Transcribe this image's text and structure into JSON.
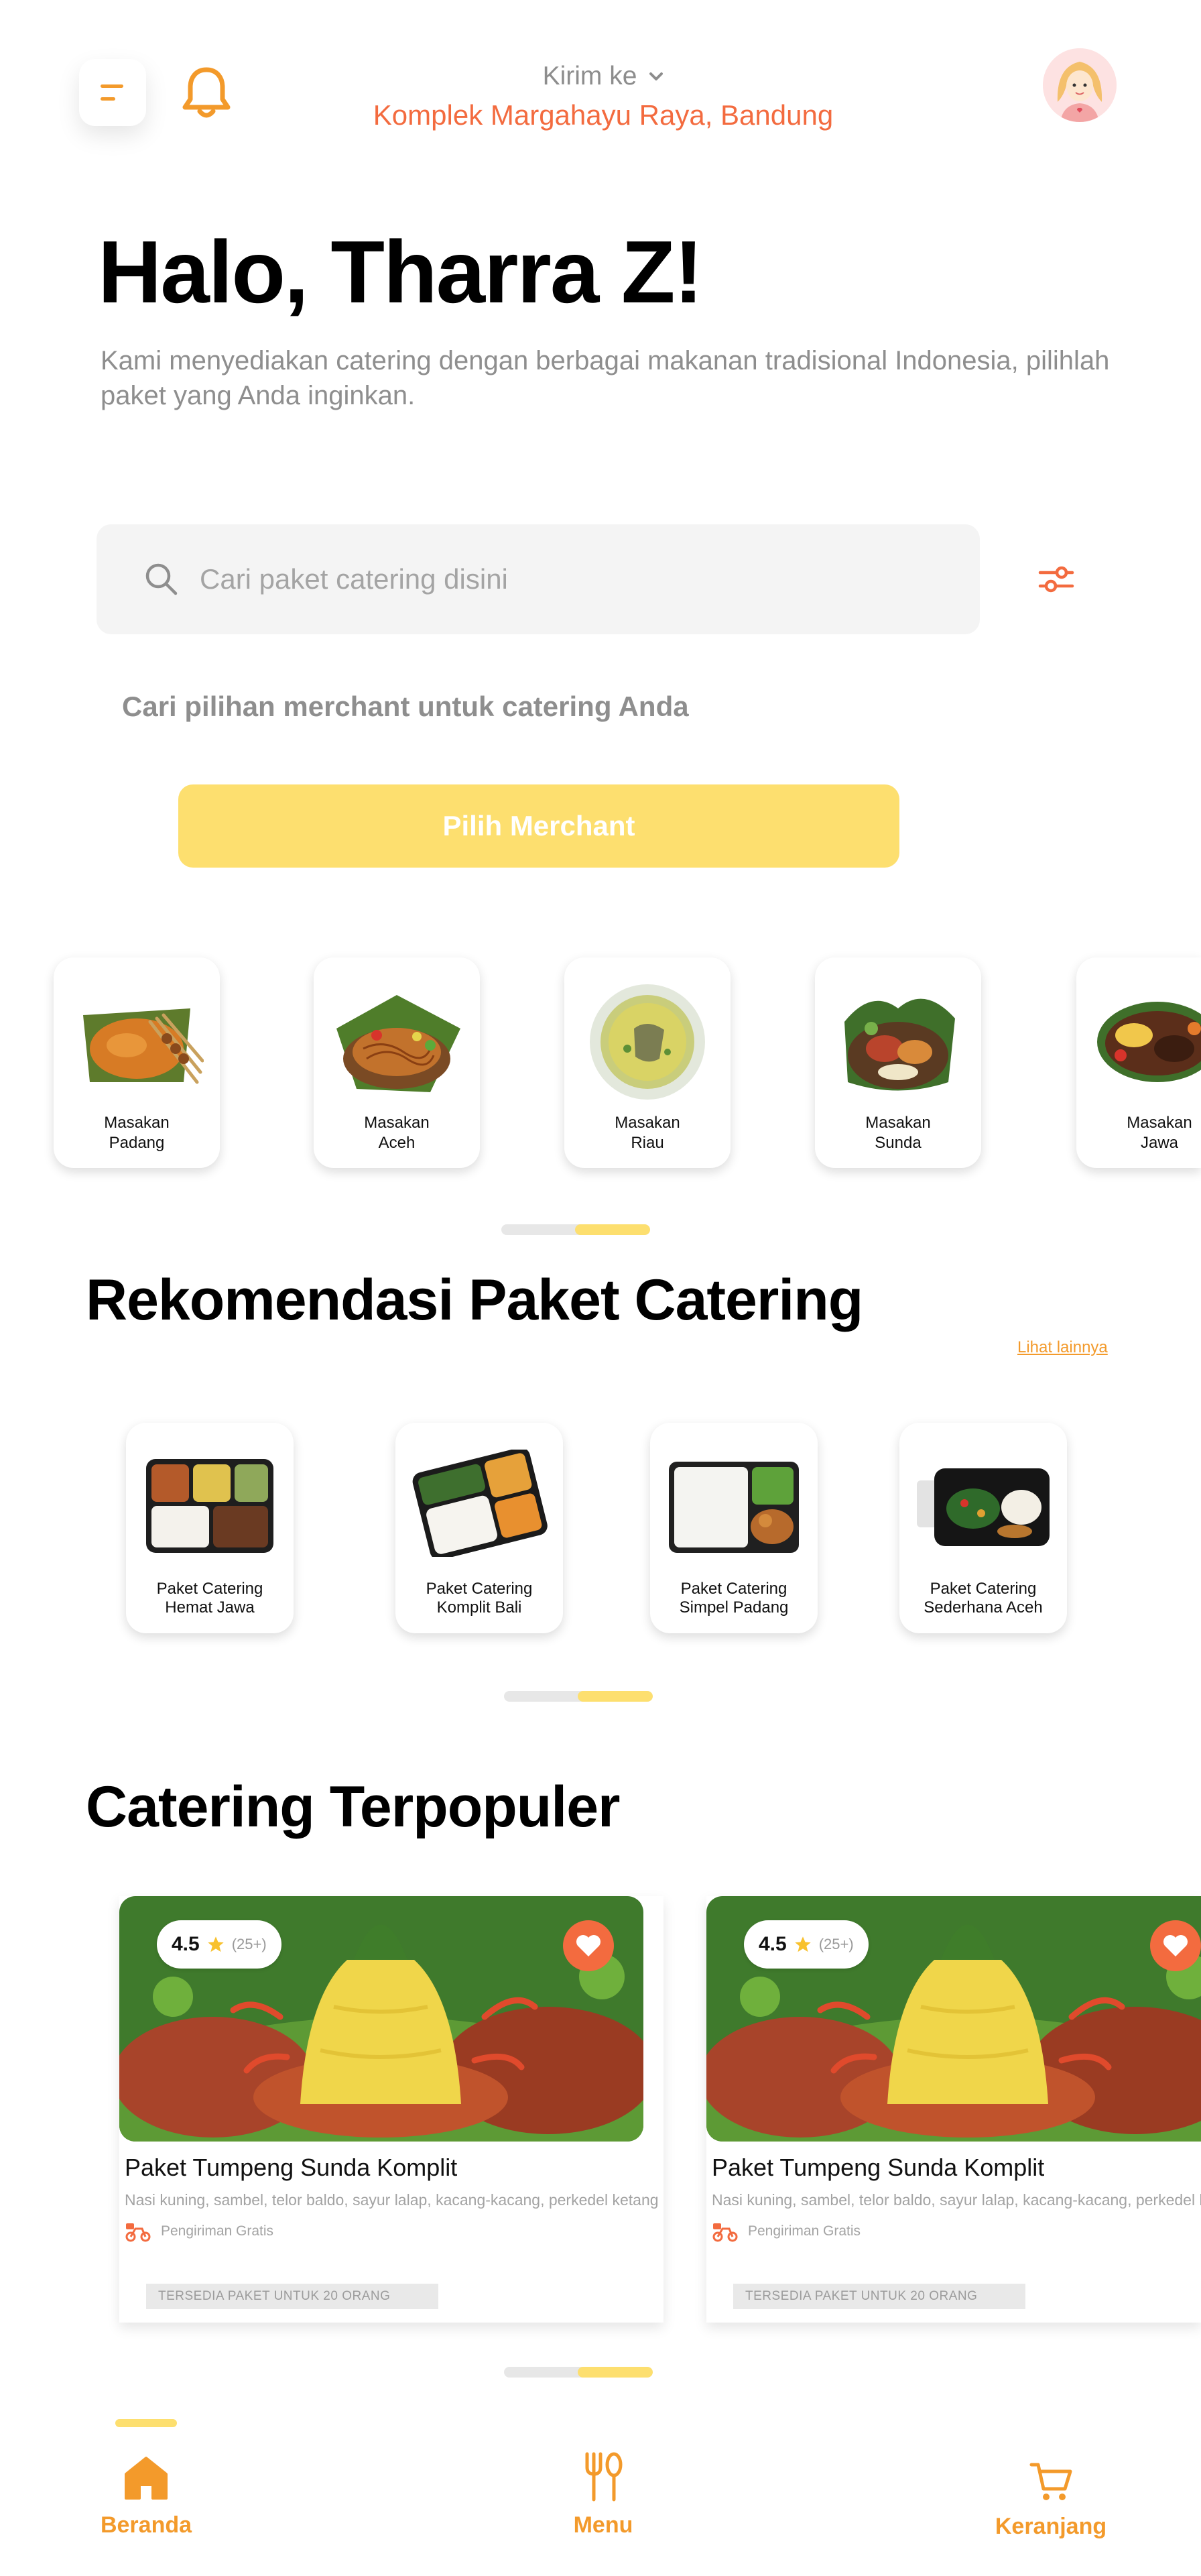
{
  "header": {
    "deliver_label": "Kirim ke",
    "address": "Komplek Margahayu Raya, Bandung"
  },
  "greeting": {
    "title": "Halo, Tharra Z!",
    "subtitle": "Kami menyediakan catering dengan berbagai makanan tradisional Indonesia, pilihlah paket yang Anda inginkan."
  },
  "search": {
    "placeholder": "Cari paket catering disini"
  },
  "merchant": {
    "hint": "Cari pilihan merchant untuk catering Anda",
    "button_label": "Pilih Merchant"
  },
  "categories": [
    {
      "line1": "Masakan",
      "line2": "Padang"
    },
    {
      "line1": "Masakan",
      "line2": "Aceh"
    },
    {
      "line1": "Masakan",
      "line2": "Riau"
    },
    {
      "line1": "Masakan",
      "line2": "Sunda"
    },
    {
      "line1": "Masakan",
      "line2": "Jawa"
    }
  ],
  "recommendations": {
    "title": "Rekomendasi Paket Catering",
    "see_more": "Lihat lainnya",
    "items": [
      {
        "line1": "Paket Catering",
        "line2": "Hemat Jawa"
      },
      {
        "line1": "Paket Catering",
        "line2": "Komplit Bali"
      },
      {
        "line1": "Paket Catering",
        "line2": "Simpel Padang"
      },
      {
        "line1": "Paket Catering",
        "line2": "Sederhana Aceh"
      }
    ]
  },
  "popular": {
    "title": "Catering Terpopuler",
    "items": [
      {
        "rating": "4.5",
        "rating_count": "(25+)",
        "name": "Paket Tumpeng Sunda Komplit",
        "description": "Nasi kuning, sambel, telor baldo, sayur lalap, kacang-kacang, perkedel ketang",
        "shipping": "Pengiriman Gratis",
        "availability": "TERSEDIA PAKET UNTUK 20 ORANG"
      },
      {
        "rating": "4.5",
        "rating_count": "(25+)",
        "name": "Paket Tumpeng Sunda Komplit",
        "description": "Nasi kuning, sambel, telor baldo, sayur lalap, kacang-kacang, perkedel ketang",
        "shipping": "Pengiriman Gratis",
        "availability": "TERSEDIA PAKET UNTUK 20 ORANG"
      }
    ]
  },
  "nav": {
    "home": "Beranda",
    "menu": "Menu",
    "cart": "Keranjang"
  },
  "colors": {
    "accent_orange": "#f39a2b",
    "address_orange": "#f36b3f",
    "button_yellow": "#fddf6f"
  },
  "icons": {
    "menu": "menu-icon",
    "bell": "bell-icon",
    "chevron": "chevron-down-icon",
    "search": "search-icon",
    "filter": "filter-icon",
    "star": "star-icon",
    "heart": "heart-icon",
    "delivery": "delivery-icon",
    "home": "home-icon",
    "cutlery": "cutlery-icon",
    "cart": "cart-icon"
  }
}
